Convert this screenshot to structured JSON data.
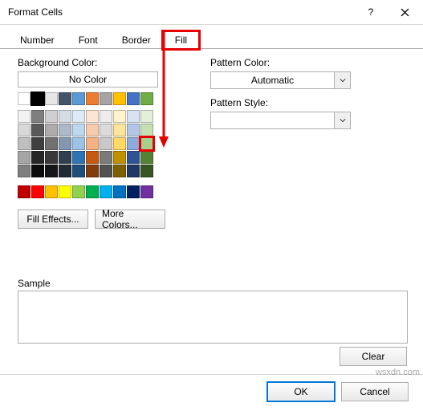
{
  "title": "Format Cells",
  "tabs": {
    "number": "Number",
    "font": "Font",
    "border": "Border",
    "fill": "Fill"
  },
  "active_tab": "fill",
  "left": {
    "bg_label": "Background Color:",
    "no_color": "No Color",
    "fill_effects": "Fill Effects...",
    "more_colors": "More Colors..."
  },
  "right": {
    "pcolor_label": "Pattern Color:",
    "pcolor_value": "Automatic",
    "pstyle_label": "Pattern Style:"
  },
  "sample_label": "Sample",
  "clear": "Clear",
  "ok": "OK",
  "cancel": "Cancel",
  "watermark": "wsxdn.com",
  "theme_colors_row1": [
    "#ffffff",
    "#000000",
    "#e7e6e6",
    "#44546a",
    "#5b9bd5",
    "#ed7d31",
    "#a5a5a5",
    "#ffc000",
    "#4472c4",
    "#70ad47"
  ],
  "theme_tints": [
    [
      "#f2f2f2",
      "#7f7f7f",
      "#d0cece",
      "#d6dce4",
      "#deebf6",
      "#fbe5d5",
      "#ededed",
      "#fff2cc",
      "#d9e2f3",
      "#e2efd9"
    ],
    [
      "#d8d8d8",
      "#595959",
      "#aeabab",
      "#adb9ca",
      "#bdd7ee",
      "#f7cbac",
      "#dbdbdb",
      "#fee599",
      "#b4c6e7",
      "#c5e0b3"
    ],
    [
      "#bfbfbf",
      "#3f3f3f",
      "#757070",
      "#8496b0",
      "#9cc3e5",
      "#f4b183",
      "#c9c9c9",
      "#ffd965",
      "#8eaadb",
      "#a8d08d"
    ],
    [
      "#a5a5a5",
      "#262626",
      "#3a3838",
      "#323f4f",
      "#2e75b5",
      "#c55a11",
      "#7b7b7b",
      "#bf9000",
      "#2f5496",
      "#538135"
    ],
    [
      "#7f7f7f",
      "#0c0c0c",
      "#171616",
      "#222a35",
      "#1e4e79",
      "#833c0b",
      "#525252",
      "#7f6000",
      "#1f3864",
      "#375623"
    ]
  ],
  "standard_colors": [
    "#c00000",
    "#ff0000",
    "#ffc000",
    "#ffff00",
    "#92d050",
    "#00b050",
    "#00b0f0",
    "#0070c0",
    "#002060",
    "#7030a0"
  ],
  "target_swatch": "theme_tints.2.9"
}
